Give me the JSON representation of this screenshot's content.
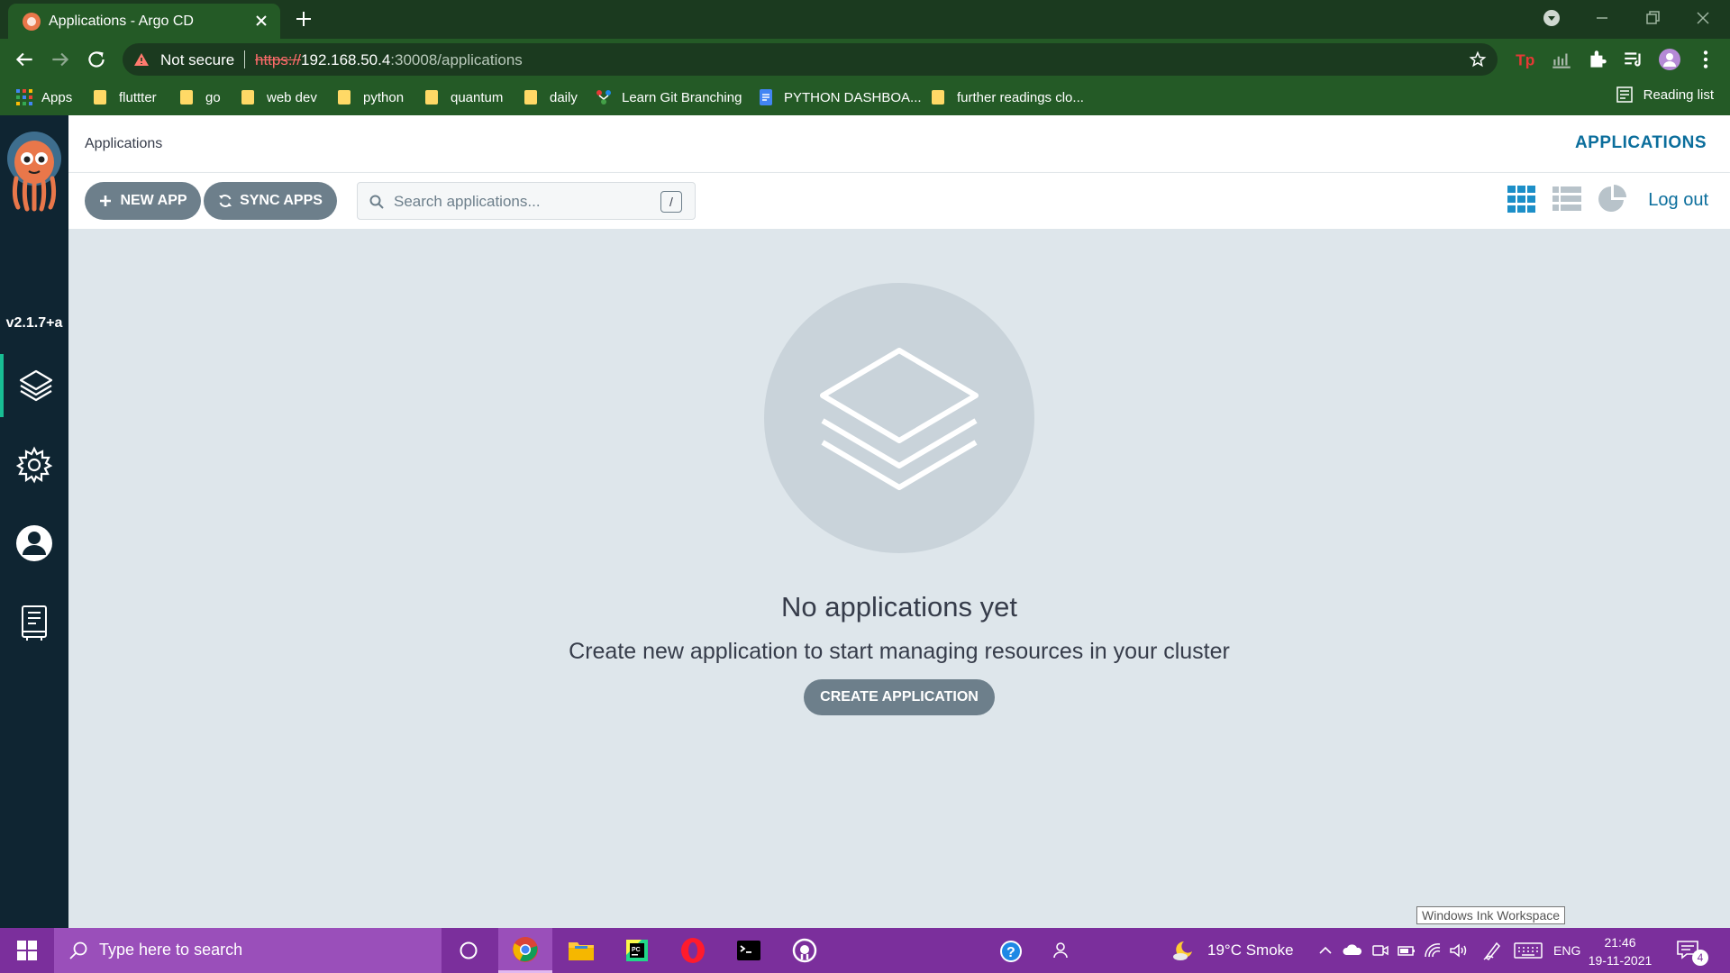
{
  "browser": {
    "tab_title": "Applications - Argo CD",
    "security_label": "Not secure",
    "url_scheme": "https://",
    "url_host": "192.168.50.4",
    "url_path": ":30008/applications",
    "bookmarks": [
      "Apps",
      "fluttter",
      "go",
      "web dev",
      "python",
      "quantum",
      "daily",
      "Learn Git Branching",
      "PYTHON DASHBOA...",
      "further readings clo..."
    ],
    "reading_list": "Reading list"
  },
  "sidebar": {
    "version": "v2.1.7+a",
    "items": [
      "applications",
      "settings",
      "user-info",
      "documentation"
    ]
  },
  "header": {
    "breadcrumb": "Applications",
    "title": "APPLICATIONS"
  },
  "actions": {
    "new_app": "NEW APP",
    "sync_apps": "SYNC APPS",
    "search_placeholder": "Search applications...",
    "search_shortcut": "/",
    "logout": "Log out"
  },
  "empty_state": {
    "title": "No applications yet",
    "description": "Create new application to start managing resources in your cluster",
    "button": "CREATE APPLICATION"
  },
  "tooltip": "Windows Ink Workspace",
  "taskbar": {
    "search_placeholder": "Type here to search",
    "weather": "19°C  Smoke",
    "language": "ENG",
    "time": "21:46",
    "date": "19-11-2021",
    "notifications": "4"
  },
  "colors": {
    "accent": "#0b6e9c",
    "button": "#6d7f8b",
    "sidebar": "#0f2532",
    "content_bg": "#dee6eb",
    "active_nav": "#18be94"
  }
}
